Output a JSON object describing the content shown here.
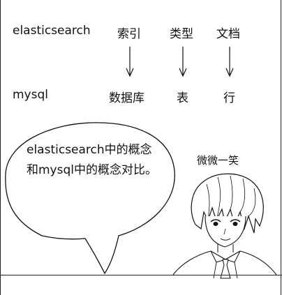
{
  "mapping": {
    "row_top": {
      "system": "elasticsearch",
      "terms": [
        "索引",
        "类型",
        "文档"
      ]
    },
    "row_bottom": {
      "system": "mysql",
      "terms": [
        "数据库",
        "表",
        "行"
      ]
    }
  },
  "speech_bubble": {
    "line1": "elasticsearch中的概念",
    "line2": "和mysql中的概念对比。"
  },
  "character": {
    "caption": "微微一笑"
  }
}
